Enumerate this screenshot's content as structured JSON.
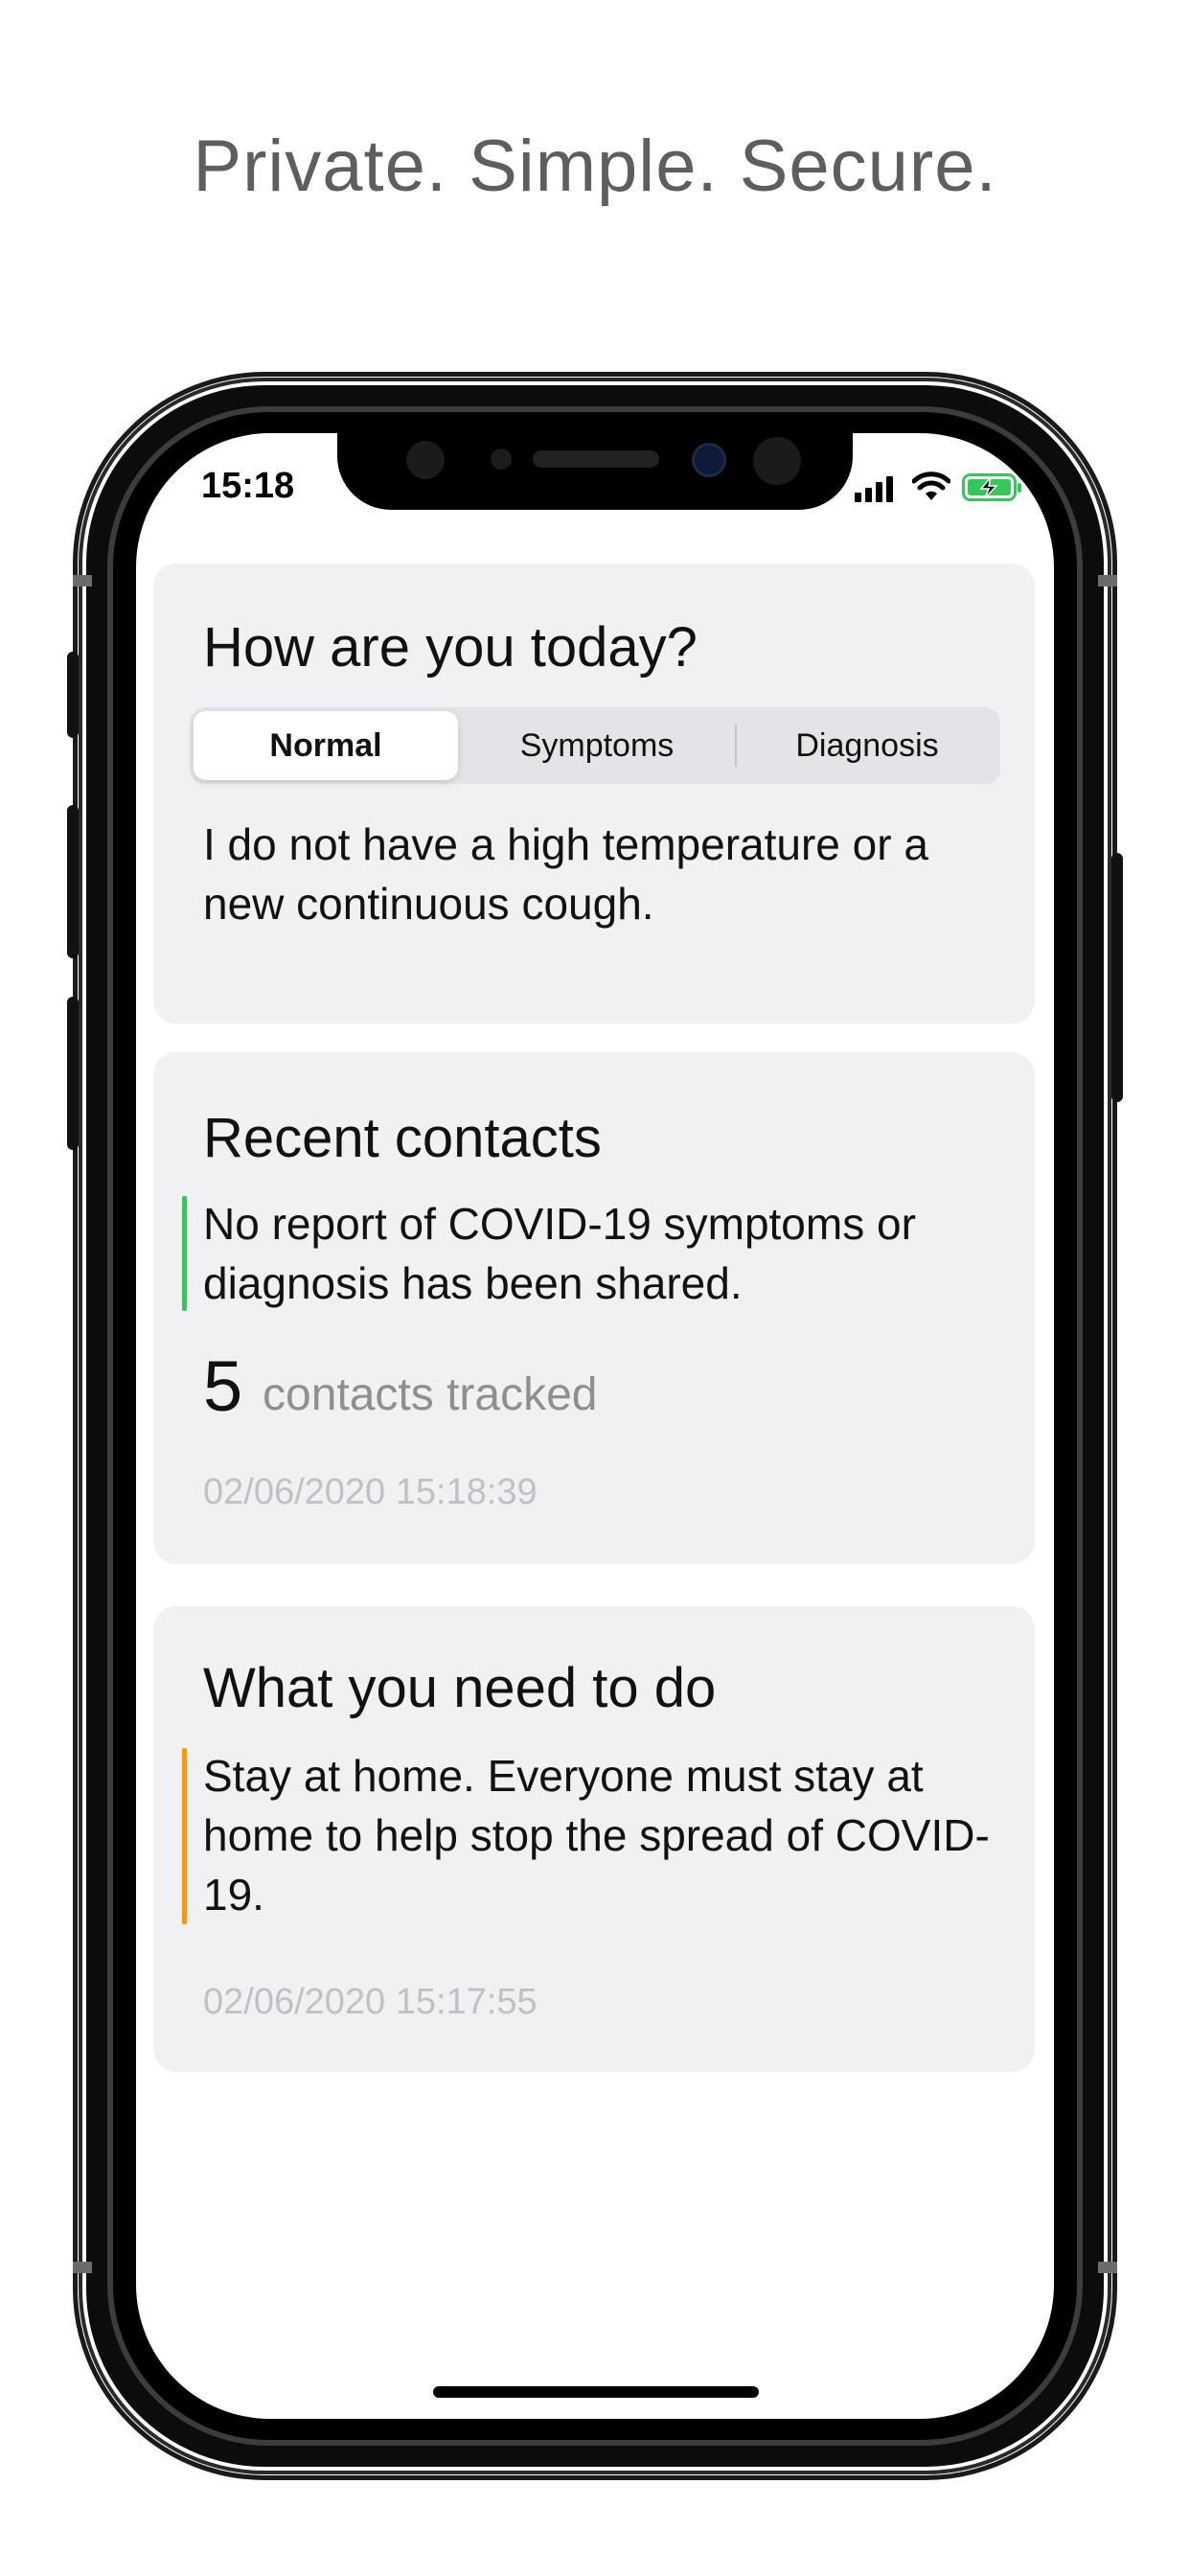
{
  "tagline": "Private. Simple. Secure.",
  "status_bar": {
    "time": "15:18",
    "icons": [
      "signal-icon",
      "wifi-icon",
      "battery-charging-icon"
    ]
  },
  "status_card": {
    "title": "How are you today?",
    "options": [
      "Normal",
      "Symptoms",
      "Diagnosis"
    ],
    "selected": "Normal",
    "description": "I do not have a high temperature or a new continuous cough."
  },
  "contacts_card": {
    "title": "Recent contacts",
    "message": "No report of COVID-19 symptoms or diagnosis has been shared.",
    "count": "5",
    "count_label": "contacts tracked",
    "timestamp": "02/06/2020 15:18:39",
    "accent_color": "#34c759"
  },
  "advice_card": {
    "title": "What you need to do",
    "message": "Stay at home. Everyone must stay at home to help stop the spread of COVID-19.",
    "timestamp": "02/06/2020 15:17:55",
    "accent_color": "#ff9500"
  }
}
